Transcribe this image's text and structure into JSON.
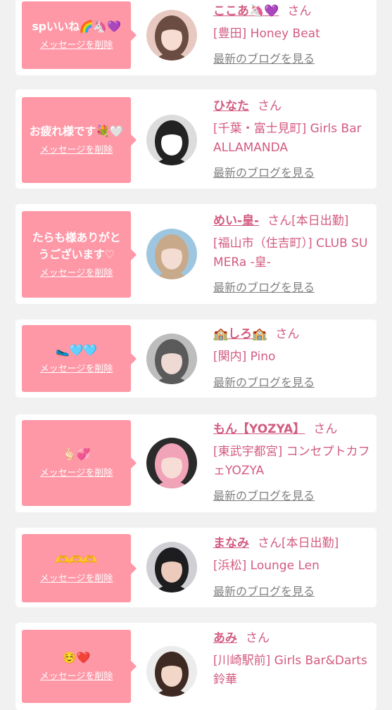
{
  "messages": [
    {
      "message": "spいいね🌈🦄💜",
      "delete_label": "メッセージを削除",
      "name": "ここあ🦄💜",
      "suffix": "さん",
      "shop": "[豊田] Honey Beat",
      "blog_label": "最新のブログを見る",
      "avatar": {
        "bg": "#e8c9c2",
        "hair": "#6b4c42",
        "skin": "#f6dcd3"
      }
    },
    {
      "message": "お疲れ様です💐🤍",
      "delete_label": "メッセージを削除",
      "name": "ひなた",
      "suffix": "さん",
      "shop": "[千葉・富士見町] Girls Bar ALLAMANDA",
      "blog_label": "最新のブログを見る",
      "avatar": {
        "bg": "#dcdcdc",
        "hair": "#222222",
        "skin": "#ffffff"
      }
    },
    {
      "message": "たらも様ありがとうございます♡",
      "delete_label": "メッセージを削除",
      "name": "めい-皇-",
      "suffix": "さん[本日出勤]",
      "shop": "[福山市（住吉町）] CLUB SUMERa -皇-",
      "blog_label": "最新のブログを見る",
      "avatar": {
        "bg": "#9fc6e0",
        "hair": "#c8a98a",
        "skin": "#f3dcd2"
      }
    },
    {
      "message": "🥿🩵🩵",
      "delete_label": "メッセージを削除",
      "name": "🏫しろ🏫",
      "suffix": "さん",
      "shop": "[関内] Pino",
      "blog_label": "最新のブログを見る",
      "avatar": {
        "bg": "#bdbdbd",
        "hair": "#5a5a5a",
        "skin": "#eed9d3"
      }
    },
    {
      "message": "🫰🏻💞",
      "delete_label": "メッセージを削除",
      "name": "もん【YOZYA】",
      "suffix": "さん",
      "shop": "[東武宇都宮] コンセプトカフェYOZYA",
      "blog_label": "最新のブログを見る",
      "avatar": {
        "bg": "#2b2b2b",
        "hair": "#f1a3b8",
        "skin": "#f7ddd6"
      }
    },
    {
      "message": "🫶🫶🫶",
      "delete_label": "メッセージを削除",
      "name": "まなみ",
      "suffix": "さん[本日出勤]",
      "shop": "[浜松] Lounge Len",
      "blog_label": "最新のブログを見る",
      "avatar": {
        "bg": "#cfcfd4",
        "hair": "#1d1d1f",
        "skin": "#eccbbd"
      }
    },
    {
      "message": "☺️❤️",
      "delete_label": "メッセージを削除",
      "name": "あみ",
      "suffix": "さん",
      "shop": "[川崎駅前] Girls Bar&Darts 鈴華",
      "blog_label": "最新のブログを見る",
      "avatar": {
        "bg": "#ececec",
        "hair": "#3e2a22",
        "skin": "#f2d6c8"
      }
    }
  ]
}
